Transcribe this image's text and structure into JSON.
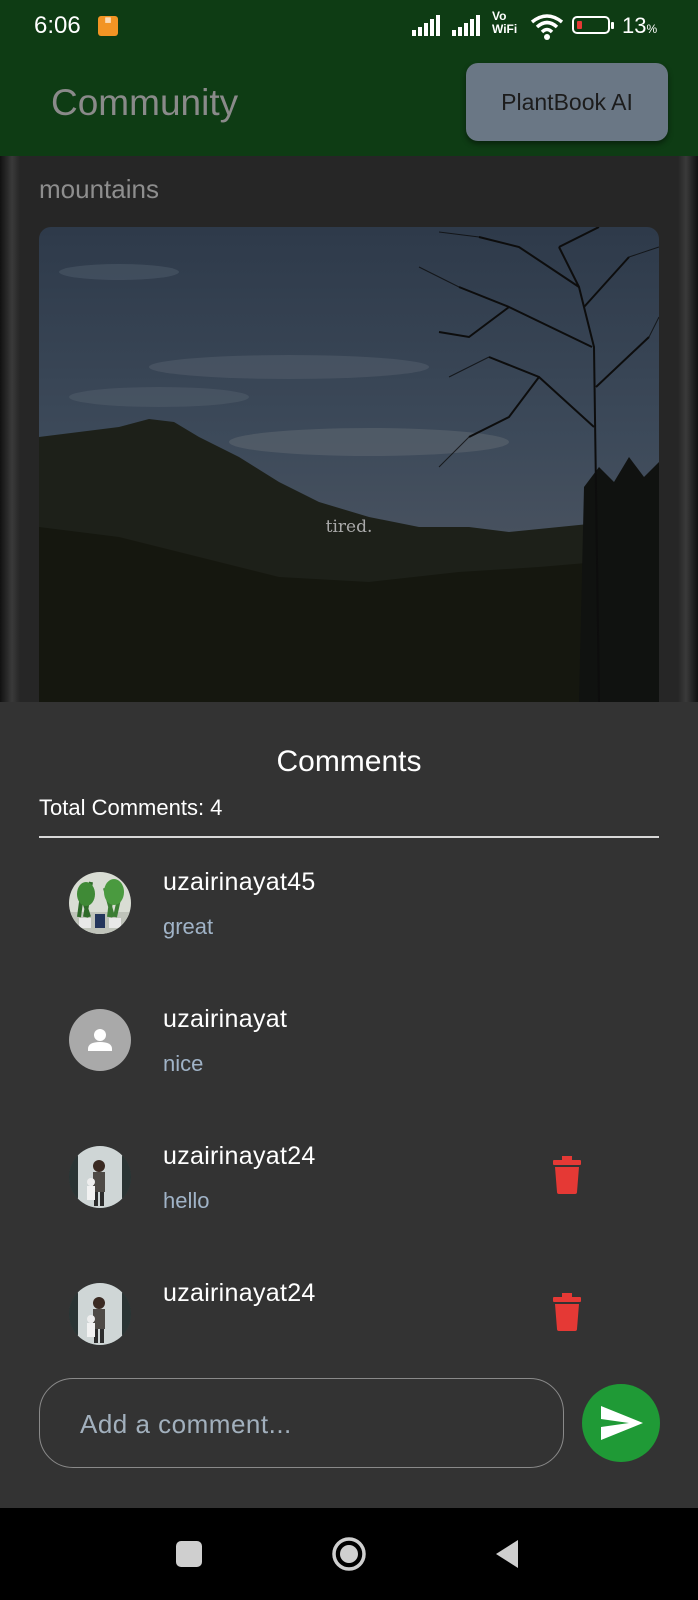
{
  "status_bar": {
    "time": "6:06",
    "notification_icon": "app-notification-icon",
    "network_label_top": "Vo",
    "network_label_bottom": "WiFi",
    "battery_percent": "13",
    "battery_unit": "%"
  },
  "app_bar": {
    "title": "Community",
    "ai_button_label": "PlantBook AI"
  },
  "post": {
    "title": "mountains",
    "image_caption": "tired."
  },
  "comments_sheet": {
    "title": "Comments",
    "total_label": "Total Comments: 4",
    "comments": [
      {
        "username": "uzairinayat45",
        "text": "great",
        "avatar": "plants-photo-avatar",
        "deletable": false
      },
      {
        "username": "uzairinayat",
        "text": "nice",
        "avatar": "default-person-avatar",
        "deletable": false
      },
      {
        "username": "uzairinayat24",
        "text": "hello",
        "avatar": "person-photo-avatar",
        "deletable": true
      },
      {
        "username": "uzairinayat24",
        "text": "",
        "avatar": "person-photo-avatar",
        "deletable": true
      }
    ],
    "input_placeholder": "Add a comment...",
    "send_icon": "send-icon"
  },
  "colors": {
    "app_bar": "#0e3c14",
    "sheet_background": "#333333",
    "send_button": "#1f9a36",
    "delete_icon": "#e53935",
    "comment_text": "#a0b3c7"
  }
}
